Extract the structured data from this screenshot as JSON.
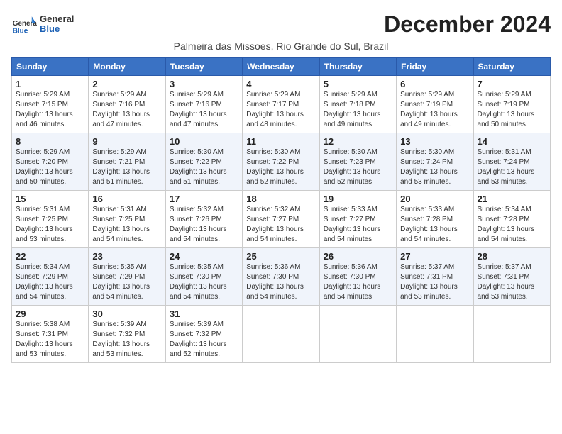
{
  "header": {
    "logo_text_general": "General",
    "logo_text_blue": "Blue",
    "month_title": "December 2024",
    "location": "Palmeira das Missoes, Rio Grande do Sul, Brazil"
  },
  "days_of_week": [
    "Sunday",
    "Monday",
    "Tuesday",
    "Wednesday",
    "Thursday",
    "Friday",
    "Saturday"
  ],
  "weeks": [
    [
      {
        "day": "1",
        "sunrise": "5:29 AM",
        "sunset": "7:15 PM",
        "daylight_h": "13",
        "daylight_m": "46"
      },
      {
        "day": "2",
        "sunrise": "5:29 AM",
        "sunset": "7:16 PM",
        "daylight_h": "13",
        "daylight_m": "47"
      },
      {
        "day": "3",
        "sunrise": "5:29 AM",
        "sunset": "7:16 PM",
        "daylight_h": "13",
        "daylight_m": "47"
      },
      {
        "day": "4",
        "sunrise": "5:29 AM",
        "sunset": "7:17 PM",
        "daylight_h": "13",
        "daylight_m": "48"
      },
      {
        "day": "5",
        "sunrise": "5:29 AM",
        "sunset": "7:18 PM",
        "daylight_h": "13",
        "daylight_m": "49"
      },
      {
        "day": "6",
        "sunrise": "5:29 AM",
        "sunset": "7:19 PM",
        "daylight_h": "13",
        "daylight_m": "49"
      },
      {
        "day": "7",
        "sunrise": "5:29 AM",
        "sunset": "7:19 PM",
        "daylight_h": "13",
        "daylight_m": "50"
      }
    ],
    [
      {
        "day": "8",
        "sunrise": "5:29 AM",
        "sunset": "7:20 PM",
        "daylight_h": "13",
        "daylight_m": "50"
      },
      {
        "day": "9",
        "sunrise": "5:29 AM",
        "sunset": "7:21 PM",
        "daylight_h": "13",
        "daylight_m": "51"
      },
      {
        "day": "10",
        "sunrise": "5:30 AM",
        "sunset": "7:22 PM",
        "daylight_h": "13",
        "daylight_m": "51"
      },
      {
        "day": "11",
        "sunrise": "5:30 AM",
        "sunset": "7:22 PM",
        "daylight_h": "13",
        "daylight_m": "52"
      },
      {
        "day": "12",
        "sunrise": "5:30 AM",
        "sunset": "7:23 PM",
        "daylight_h": "13",
        "daylight_m": "52"
      },
      {
        "day": "13",
        "sunrise": "5:30 AM",
        "sunset": "7:24 PM",
        "daylight_h": "13",
        "daylight_m": "53"
      },
      {
        "day": "14",
        "sunrise": "5:31 AM",
        "sunset": "7:24 PM",
        "daylight_h": "13",
        "daylight_m": "53"
      }
    ],
    [
      {
        "day": "15",
        "sunrise": "5:31 AM",
        "sunset": "7:25 PM",
        "daylight_h": "13",
        "daylight_m": "53"
      },
      {
        "day": "16",
        "sunrise": "5:31 AM",
        "sunset": "7:25 PM",
        "daylight_h": "13",
        "daylight_m": "54"
      },
      {
        "day": "17",
        "sunrise": "5:32 AM",
        "sunset": "7:26 PM",
        "daylight_h": "13",
        "daylight_m": "54"
      },
      {
        "day": "18",
        "sunrise": "5:32 AM",
        "sunset": "7:27 PM",
        "daylight_h": "13",
        "daylight_m": "54"
      },
      {
        "day": "19",
        "sunrise": "5:33 AM",
        "sunset": "7:27 PM",
        "daylight_h": "13",
        "daylight_m": "54"
      },
      {
        "day": "20",
        "sunrise": "5:33 AM",
        "sunset": "7:28 PM",
        "daylight_h": "13",
        "daylight_m": "54"
      },
      {
        "day": "21",
        "sunrise": "5:34 AM",
        "sunset": "7:28 PM",
        "daylight_h": "13",
        "daylight_m": "54"
      }
    ],
    [
      {
        "day": "22",
        "sunrise": "5:34 AM",
        "sunset": "7:29 PM",
        "daylight_h": "13",
        "daylight_m": "54"
      },
      {
        "day": "23",
        "sunrise": "5:35 AM",
        "sunset": "7:29 PM",
        "daylight_h": "13",
        "daylight_m": "54"
      },
      {
        "day": "24",
        "sunrise": "5:35 AM",
        "sunset": "7:30 PM",
        "daylight_h": "13",
        "daylight_m": "54"
      },
      {
        "day": "25",
        "sunrise": "5:36 AM",
        "sunset": "7:30 PM",
        "daylight_h": "13",
        "daylight_m": "54"
      },
      {
        "day": "26",
        "sunrise": "5:36 AM",
        "sunset": "7:30 PM",
        "daylight_h": "13",
        "daylight_m": "54"
      },
      {
        "day": "27",
        "sunrise": "5:37 AM",
        "sunset": "7:31 PM",
        "daylight_h": "13",
        "daylight_m": "53"
      },
      {
        "day": "28",
        "sunrise": "5:37 AM",
        "sunset": "7:31 PM",
        "daylight_h": "13",
        "daylight_m": "53"
      }
    ],
    [
      {
        "day": "29",
        "sunrise": "5:38 AM",
        "sunset": "7:31 PM",
        "daylight_h": "13",
        "daylight_m": "53"
      },
      {
        "day": "30",
        "sunrise": "5:39 AM",
        "sunset": "7:32 PM",
        "daylight_h": "13",
        "daylight_m": "53"
      },
      {
        "day": "31",
        "sunrise": "5:39 AM",
        "sunset": "7:32 PM",
        "daylight_h": "13",
        "daylight_m": "52"
      },
      null,
      null,
      null,
      null
    ]
  ]
}
